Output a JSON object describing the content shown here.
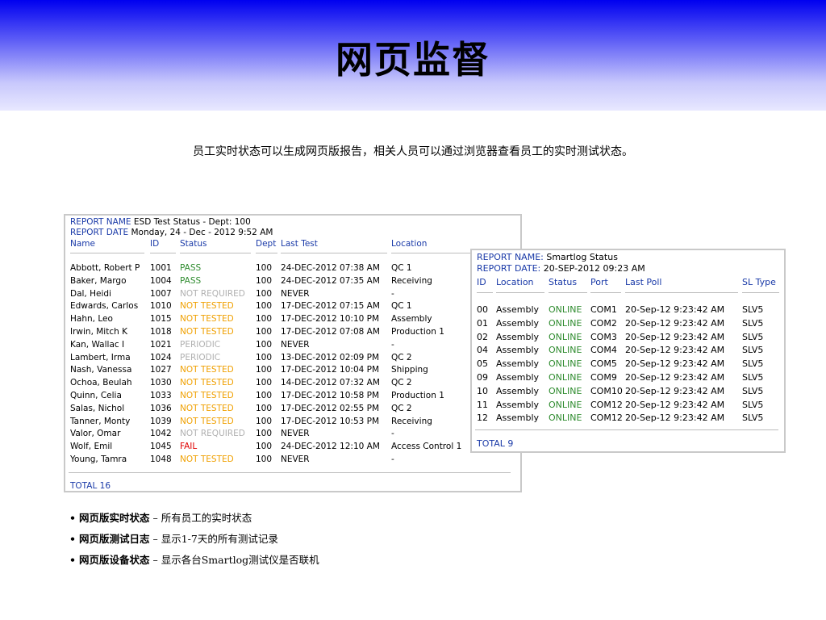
{
  "slide": {
    "title": "网页监督",
    "intro": "员工实时状态可以生成网页版报告，相关人员可以通过浏览器查看员工的实时测试状态。"
  },
  "report1": {
    "name_key": "REPORT NAME",
    "name_value": "ESD Test Status - Dept: 100",
    "date_key": "REPORT DATE",
    "date_value": "Monday, 24 - Dec - 2012 9:52 AM",
    "columns": [
      "Name",
      "ID",
      "Status",
      "Dept",
      "Last Test",
      "Location"
    ],
    "rows": [
      [
        "Abbott, Robert P",
        "1001",
        "PASS",
        "100",
        "24-DEC-2012 07:38 AM",
        "QC 1"
      ],
      [
        "Baker, Margo",
        "1004",
        "PASS",
        "100",
        "24-DEC-2012 07:35 AM",
        "Receiving"
      ],
      [
        "Dal, Heidi",
        "1007",
        "NOT REQUIRED",
        "100",
        "NEVER",
        "-"
      ],
      [
        "Edwards, Carlos",
        "1010",
        "NOT TESTED",
        "100",
        "17-DEC-2012 07:15 AM",
        "QC 1"
      ],
      [
        "Hahn, Leo",
        "1015",
        "NOT TESTED",
        "100",
        "17-DEC-2012 10:10 PM",
        "Assembly"
      ],
      [
        "Irwin, Mitch K",
        "1018",
        "NOT TESTED",
        "100",
        "17-DEC-2012 07:08 AM",
        "Production 1"
      ],
      [
        "Kan, Wallac I",
        "1021",
        "PERIODIC",
        "100",
        "NEVER",
        "-"
      ],
      [
        "Lambert, Irma",
        "1024",
        "PERIODIC",
        "100",
        "13-DEC-2012 02:09 PM",
        "QC 2"
      ],
      [
        "Nash, Vanessa",
        "1027",
        "NOT TESTED",
        "100",
        "17-DEC-2012 10:04 PM",
        "Shipping"
      ],
      [
        "Ochoa, Beulah",
        "1030",
        "NOT TESTED",
        "100",
        "14-DEC-2012 07:32 AM",
        "QC 2"
      ],
      [
        "Quinn, Celia",
        "1033",
        "NOT TESTED",
        "100",
        "17-DEC-2012 10:58 PM",
        "Production 1"
      ],
      [
        "Salas, Nichol",
        "1036",
        "NOT TESTED",
        "100",
        "17-DEC-2012 02:55 PM",
        "QC 2"
      ],
      [
        "Tanner, Monty",
        "1039",
        "NOT TESTED",
        "100",
        "17-DEC-2012 10:53 PM",
        "Receiving"
      ],
      [
        "Valor, Omar",
        "1042",
        "NOT REQUIRED",
        "100",
        "NEVER",
        "-"
      ],
      [
        "Wolf, Emil",
        "1045",
        "FAIL",
        "100",
        "24-DEC-2012 12:10 AM",
        "Access Control 1"
      ],
      [
        "Young, Tamra",
        "1048",
        "NOT TESTED",
        "100",
        "NEVER",
        "-"
      ]
    ],
    "total": "TOTAL 16"
  },
  "report2": {
    "name_key": "REPORT NAME:",
    "name_value": "Smartlog Status",
    "date_key": "REPORT DATE:",
    "date_value": "20-SEP-2012 09:23 AM",
    "columns": [
      "ID",
      "Location",
      "Status",
      "Port",
      "Last Poll",
      "SL Type"
    ],
    "rows": [
      [
        "00",
        "Assembly",
        "ONLINE",
        "COM1",
        "20-Sep-12 9:23:42 AM",
        "SLV5"
      ],
      [
        "01",
        "Assembly",
        "ONLINE",
        "COM2",
        "20-Sep-12 9:23:42 AM",
        "SLV5"
      ],
      [
        "02",
        "Assembly",
        "ONLINE",
        "COM3",
        "20-Sep-12 9:23:42 AM",
        "SLV5"
      ],
      [
        "04",
        "Assembly",
        "ONLINE",
        "COM4",
        "20-Sep-12 9:23:42 AM",
        "SLV5"
      ],
      [
        "05",
        "Assembly",
        "ONLINE",
        "COM5",
        "20-Sep-12 9:23:42 AM",
        "SLV5"
      ],
      [
        "09",
        "Assembly",
        "ONLINE",
        "COM9",
        "20-Sep-12 9:23:42 AM",
        "SLV5"
      ],
      [
        "10",
        "Assembly",
        "ONLINE",
        "COM10",
        "20-Sep-12 9:23:42 AM",
        "SLV5"
      ],
      [
        "11",
        "Assembly",
        "ONLINE",
        "COM12",
        "20-Sep-12 9:23:42 AM",
        "SLV5"
      ],
      [
        "12",
        "Assembly",
        "ONLINE",
        "COM12",
        "20-Sep-12 9:23:42 AM",
        "SLV5"
      ]
    ],
    "total": "TOTAL 9"
  },
  "bullets": [
    {
      "label": "网页版实时状态",
      "sep": " – ",
      "text": "所有员工的实时状态"
    },
    {
      "label": "网页版测试日志",
      "sep": " – ",
      "text": "显示1-7天的所有测试记录"
    },
    {
      "label": "网页版设备状态",
      "sep": " – ",
      "text": "显示各台Smartlog测试仪是否联机"
    }
  ],
  "colors": {
    "header_top": "#0000f0",
    "header_bottom": "#e8e8ff",
    "report_key": "#1a3aa8",
    "status_pass": "#2e8b2e",
    "status_not_tested": "#f0a000",
    "status_not_required": "#b0b0b0",
    "status_fail": "#e00000"
  }
}
